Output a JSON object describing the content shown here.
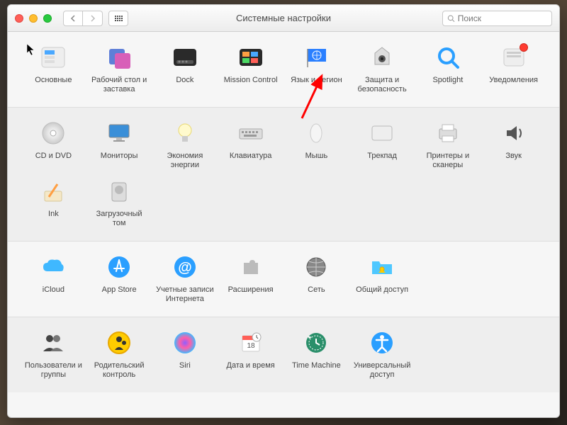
{
  "window_title": "Системные настройки",
  "search_placeholder": "Поиск",
  "sections": [
    [
      {
        "id": "general",
        "label": "Основные"
      },
      {
        "id": "desktop",
        "label": "Рабочий стол и заставка"
      },
      {
        "id": "dock",
        "label": "Dock"
      },
      {
        "id": "mission",
        "label": "Mission Control"
      },
      {
        "id": "lang",
        "label": "Язык и регион"
      },
      {
        "id": "security",
        "label": "Защита и безопасность"
      },
      {
        "id": "spotlight",
        "label": "Spotlight"
      },
      {
        "id": "notifications",
        "label": "Уведомления",
        "badge": true
      }
    ],
    [
      {
        "id": "cddvd",
        "label": "CD и DVD"
      },
      {
        "id": "displays",
        "label": "Мониторы"
      },
      {
        "id": "energy",
        "label": "Экономия энергии"
      },
      {
        "id": "keyboard",
        "label": "Клавиатура"
      },
      {
        "id": "mouse",
        "label": "Мышь"
      },
      {
        "id": "trackpad",
        "label": "Трекпад"
      },
      {
        "id": "printers",
        "label": "Принтеры и сканеры"
      },
      {
        "id": "sound",
        "label": "Звук"
      },
      {
        "id": "ink",
        "label": "Ink"
      },
      {
        "id": "startup",
        "label": "Загрузочный том"
      }
    ],
    [
      {
        "id": "icloud",
        "label": "iCloud"
      },
      {
        "id": "appstore",
        "label": "App Store"
      },
      {
        "id": "accounts",
        "label": "Учетные записи Интернета"
      },
      {
        "id": "extensions",
        "label": "Расширения"
      },
      {
        "id": "network",
        "label": "Сеть"
      },
      {
        "id": "sharing",
        "label": "Общий доступ"
      }
    ],
    [
      {
        "id": "users",
        "label": "Пользователи и группы"
      },
      {
        "id": "parental",
        "label": "Родительский контроль"
      },
      {
        "id": "siri",
        "label": "Siri"
      },
      {
        "id": "datetime",
        "label": "Дата и время"
      },
      {
        "id": "timemachine",
        "label": "Time Machine"
      },
      {
        "id": "accessibility",
        "label": "Универсальный доступ"
      }
    ]
  ]
}
